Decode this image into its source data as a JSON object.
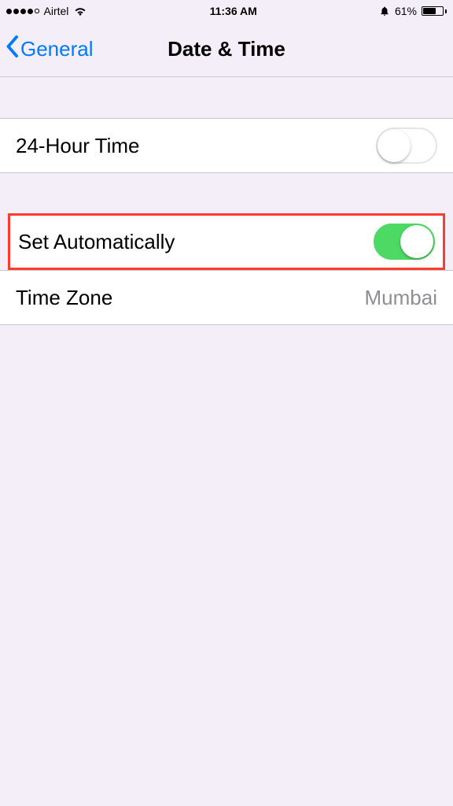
{
  "status": {
    "carrier": "Airtel",
    "time": "11:36 AM",
    "battery_percent": "61%"
  },
  "nav": {
    "back_label": "General",
    "title": "Date & Time"
  },
  "settings": {
    "twenty_four_hour": {
      "label": "24-Hour Time",
      "on": false
    },
    "set_automatically": {
      "label": "Set Automatically",
      "on": true
    },
    "time_zone": {
      "label": "Time Zone",
      "value": "Mumbai"
    }
  }
}
